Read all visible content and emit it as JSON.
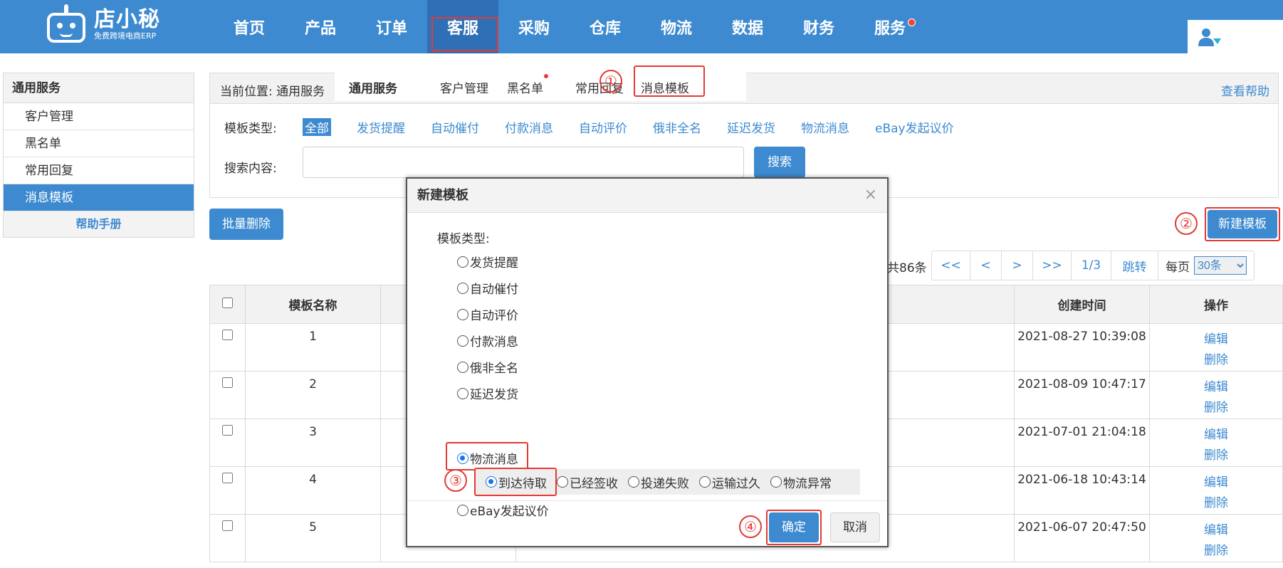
{
  "header": {
    "brand": "店小秘",
    "brand_sub": "免费跨境电商ERP",
    "nav": [
      "首页",
      "产品",
      "订单",
      "客服",
      "采购",
      "仓库",
      "物流",
      "数据",
      "财务",
      "服务"
    ],
    "active_nav": "客服"
  },
  "sidebar": {
    "title": "通用服务",
    "items": [
      "客户管理",
      "黑名单",
      "常用回复",
      "消息模板"
    ],
    "selected": "消息模板",
    "help": "帮助手册"
  },
  "breadcrumb": {
    "label": "当前位置:",
    "path": "通用服务",
    "help_link": "查看帮助"
  },
  "subnav": {
    "items": [
      "通用服务",
      "客户管理",
      "黑名单",
      "常用回复",
      "消息模板"
    ]
  },
  "filter": {
    "type_label": "模板类型:",
    "types": [
      "全部",
      "发货提醒",
      "自动催付",
      "付款消息",
      "自动评价",
      "俄非全名",
      "延迟发货",
      "物流消息",
      "eBay发起议价"
    ],
    "search_label": "搜索内容:",
    "search_value": "",
    "search_button": "搜索"
  },
  "actions": {
    "batch_delete": "批量删除",
    "new_template": "新建模板"
  },
  "pagination": {
    "total": "共86条",
    "buttons": [
      "<<",
      "<",
      ">",
      ">>",
      "1/3",
      "跳转"
    ],
    "per_page_label": "每页",
    "per_page_value": "30条"
  },
  "table": {
    "headers": {
      "name": "模板名称",
      "created": "创建时间",
      "ops": "操作"
    },
    "rows": [
      {
        "name": "1",
        "created": "2021-08-27 10:39:08"
      },
      {
        "name": "2",
        "created": "2021-08-09 10:47:17"
      },
      {
        "name": "3",
        "created": "2021-07-01 21:04:18"
      },
      {
        "name": "4",
        "created": "2021-06-18 10:43:14"
      },
      {
        "name": "5",
        "created": "2021-06-07 20:47:50"
      }
    ],
    "edit_label": "编辑",
    "delete_label": "删除"
  },
  "modal": {
    "title": "新建模板",
    "close": "×",
    "type_label": "模板类型:",
    "options": [
      "发货提醒",
      "自动催付",
      "自动评价",
      "付款消息",
      "俄非全名",
      "延迟发货",
      "物流消息",
      "eBay发起议价"
    ],
    "selected_option": "物流消息",
    "sub_options": [
      "到达待取",
      "已经签收",
      "投递失败",
      "运输过久",
      "物流异常"
    ],
    "selected_sub_option": "到达待取",
    "ok": "确定",
    "cancel": "取消"
  },
  "annotations": [
    "①",
    "②",
    "③",
    "④"
  ],
  "colors": {
    "primary": "#3d8ad0",
    "highlight": "#e53935",
    "header_bg": "#3d8ad0"
  }
}
